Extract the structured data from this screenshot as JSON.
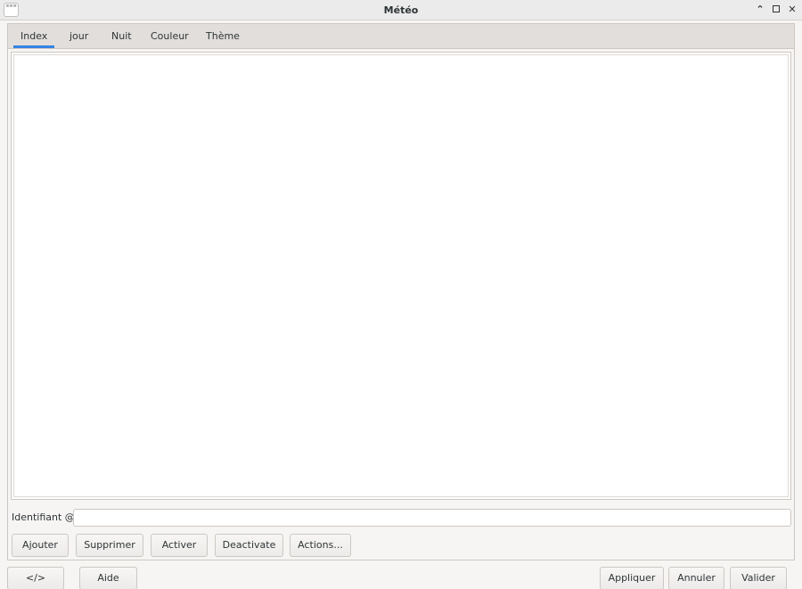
{
  "window": {
    "title": "Météo",
    "app_icon_text": "≡≡≡",
    "controls": {
      "minimize_glyph": "⌃",
      "close_glyph": "✕"
    }
  },
  "tabs": [
    {
      "label": "Index",
      "active": true
    },
    {
      "label": "jour",
      "active": false
    },
    {
      "label": "Nuit",
      "active": false
    },
    {
      "label": "Couleur",
      "active": false
    },
    {
      "label": "Thème",
      "active": false
    }
  ],
  "index_page": {
    "identifier_label": "Identifiant @",
    "identifier_value": "",
    "buttons": {
      "add": "Ajouter",
      "remove": "Supprimer",
      "activate": "Activer",
      "deactivate": "Deactivate",
      "actions": "Actions..."
    }
  },
  "dialog_buttons": {
    "code": "</>",
    "help": "Aide",
    "apply": "Appliquer",
    "cancel": "Annuler",
    "ok": "Valider"
  },
  "colors": {
    "accent": "#3584e4",
    "background": "#f6f5f4",
    "border": "#cdc7c2"
  }
}
